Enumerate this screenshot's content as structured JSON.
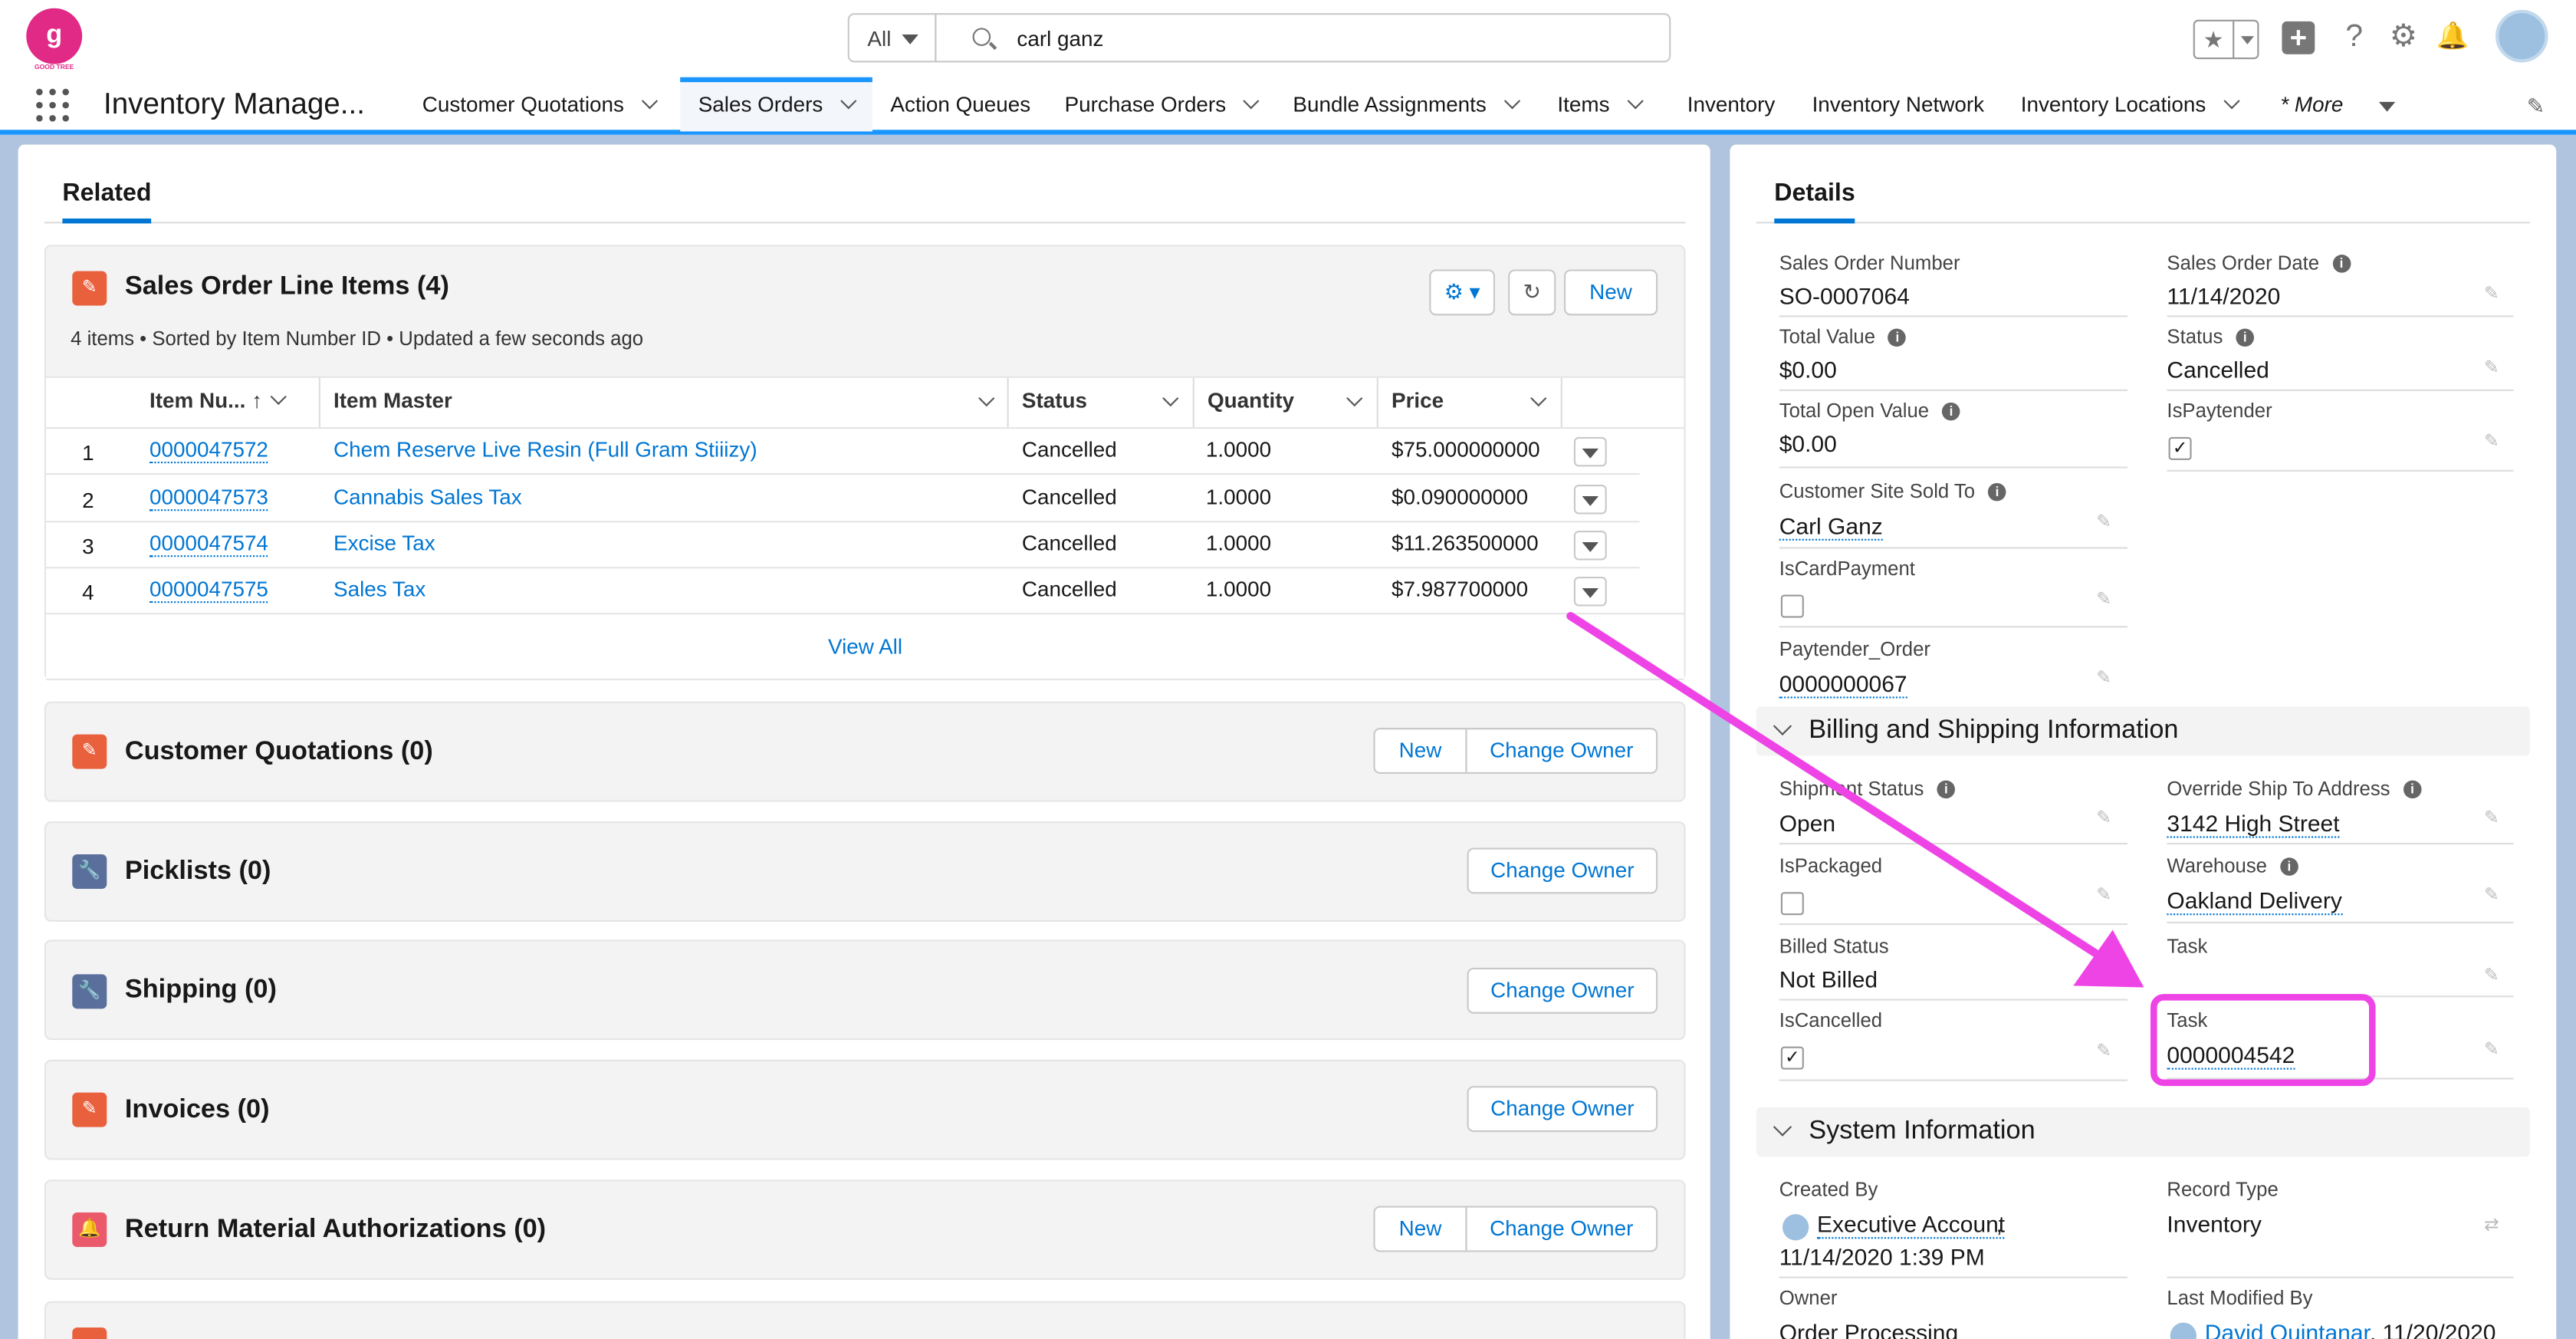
{
  "header": {
    "logo_text": "g",
    "logo_caption": "GOOD TREE",
    "search_scope": "All",
    "search_value": "carl ganz",
    "icons": [
      "favorites-star-icon",
      "add-icon",
      "help-icon",
      "setup-gear-icon",
      "notification-bell-icon",
      "user-avatar-icon"
    ]
  },
  "nav": {
    "app_title": "Inventory Manage...",
    "tabs": [
      "Customer Quotations",
      "Sales Orders",
      "Action Queues",
      "Purchase Orders",
      "Bundle Assignments",
      "Items",
      "Inventory",
      "Inventory Network",
      "Inventory Locations"
    ],
    "active_tab": "Sales Orders",
    "more_label": "* More"
  },
  "related": {
    "tab_label": "Related",
    "line_items": {
      "title": "Sales Order Line Items (4)",
      "meta": "4 items • Sorted by Item Number ID • Updated a few seconds ago",
      "new_label": "New",
      "columns": [
        "Item Nu...",
        "Item Master",
        "Status",
        "Quantity",
        "Price"
      ],
      "rows": [
        {
          "num": "1",
          "item": "0000047572",
          "master": "Chem Reserve Live Resin (Full Gram Stiiizy)",
          "status": "Cancelled",
          "qty": "1.0000",
          "price": "$75.000000000"
        },
        {
          "num": "2",
          "item": "0000047573",
          "master": "Cannabis Sales Tax",
          "status": "Cancelled",
          "qty": "1.0000",
          "price": "$0.090000000"
        },
        {
          "num": "3",
          "item": "0000047574",
          "master": "Excise Tax",
          "status": "Cancelled",
          "qty": "1.0000",
          "price": "$11.263500000"
        },
        {
          "num": "4",
          "item": "0000047575",
          "master": "Sales Tax",
          "status": "Cancelled",
          "qty": "1.0000",
          "price": "$7.987700000"
        }
      ],
      "view_all": "View All"
    },
    "lists": [
      {
        "title": "Customer Quotations (0)",
        "new": "New",
        "owner": "Change Owner"
      },
      {
        "title": "Picklists (0)",
        "owner": "Change Owner"
      },
      {
        "title": "Shipping (0)",
        "owner": "Change Owner"
      },
      {
        "title": "Invoices (0)",
        "owner": "Change Owner"
      },
      {
        "title": "Return Material Authorizations (0)",
        "new": "New",
        "owner": "Change Owner"
      }
    ]
  },
  "details": {
    "tab_label": "Details",
    "f": {
      "son_l": "Sales Order Number",
      "son_v": "SO-0007064",
      "sod_l": "Sales Order Date",
      "sod_v": "11/14/2020",
      "tv_l": "Total Value",
      "tv_v": "$0.00",
      "st_l": "Status",
      "st_v": "Cancelled",
      "tov_l": "Total Open Value",
      "tov_v": "$0.00",
      "isp_l": "IsPaytender",
      "cst_l": "Customer Site Sold To",
      "cst_v": "Carl Ganz",
      "icp_l": "IsCardPayment",
      "po_l": "Paytender_Order",
      "po_v": "0000000067"
    },
    "billing": {
      "title": "Billing and Shipping Information",
      "ss_l": "Shipment Status",
      "ss_v": "Open",
      "ost_l": "Override Ship To Address",
      "ost_v": "3142 High Street",
      "ipk_l": "IsPackaged",
      "wh_l": "Warehouse",
      "wh_v": "Oakland Delivery",
      "bs_l": "Billed Status",
      "bs_v": "Not Billed",
      "t1_l": "Task",
      "ic_l": "IsCancelled",
      "t2_l": "Task",
      "t2_v": "0000004542"
    },
    "system": {
      "title": "System Information",
      "cb_l": "Created By",
      "cb_v": "Executive Account",
      "cb_date": "11/14/2020 1:39 PM",
      "rt_l": "Record Type",
      "rt_v": "Inventory",
      "ow_l": "Owner",
      "ow_v": "Order Processing",
      "lm_l": "Last Modified By",
      "lm_v": "David Quintanar",
      "lm_date": ", 11/20/2020"
    }
  },
  "colors": {
    "brand": "#0176d3",
    "annotation": "#ee44e6",
    "logo": "#e02a86",
    "blue_frame": "#b0c4df"
  }
}
